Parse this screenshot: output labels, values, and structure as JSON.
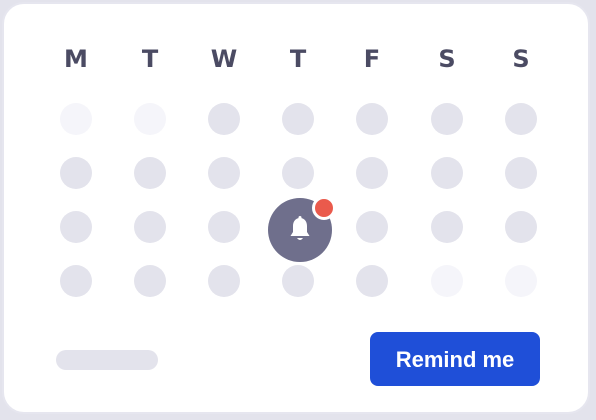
{
  "calendar": {
    "weekdays": [
      "M",
      "T",
      "W",
      "T",
      "F",
      "S",
      "S"
    ],
    "rows": [
      [
        "faded",
        "faded",
        "active",
        "active",
        "active",
        "active",
        "active"
      ],
      [
        "active",
        "active",
        "active",
        "active",
        "active",
        "active",
        "active"
      ],
      [
        "active",
        "active",
        "active",
        "bell",
        "active",
        "active",
        "active"
      ],
      [
        "active",
        "active",
        "active",
        "active",
        "active",
        "faded",
        "faded"
      ]
    ]
  },
  "reminder": {
    "icon": "bell-icon",
    "badge_color": "#ea5a4c",
    "has_notification": true
  },
  "footer": {
    "remind_label": "Remind me"
  },
  "colors": {
    "accent": "#1f4fd8",
    "dot_active": "#e3e3ec",
    "dot_faded": "#f5f5fa",
    "bell_bg": "#6f6f8c",
    "text": "#4b4b63"
  }
}
